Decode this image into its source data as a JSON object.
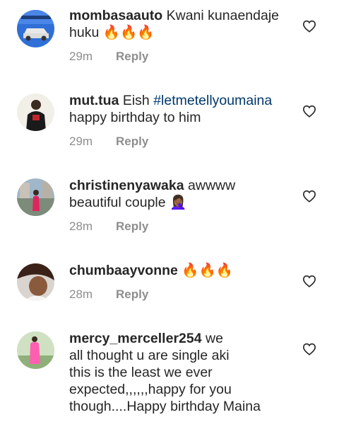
{
  "comments": [
    {
      "username": "mombasaauto",
      "text_line1": "Kwani kunaendaje",
      "text_line2": "huku 🔥🔥🔥",
      "time": "29m",
      "reply": "Reply",
      "avatar_icon": "car-avatar"
    },
    {
      "username": "mut.tua",
      "text_pre": "Eish",
      "hashtag": "#letmetellyoumaina",
      "text_line2": "happy birthday to him",
      "time": "29m",
      "reply": "Reply",
      "avatar_icon": "person-avatar"
    },
    {
      "username": "christinenyawaka",
      "text_line1": "awwww",
      "text_line2": "beautiful couple 🤦🏾‍♀️",
      "time": "28m",
      "reply": "Reply",
      "avatar_icon": "person-avatar"
    },
    {
      "username": "chumbaayvonne",
      "text_line1": "🔥🔥🔥",
      "time": "28m",
      "reply": "Reply",
      "avatar_icon": "person-avatar"
    },
    {
      "username": "mercy_merceller254",
      "text_line1": "we",
      "text_rest": "all thought u are single aki\nthis is the least we ever\nexpected,,,,,,happy for you\nthough....Happy birthday Maina",
      "avatar_icon": "person-avatar"
    }
  ],
  "colors": {
    "text": "#262626",
    "muted": "#8e8e8e",
    "hashtag": "#00376b"
  },
  "heart_icon": "heart-outline-icon"
}
